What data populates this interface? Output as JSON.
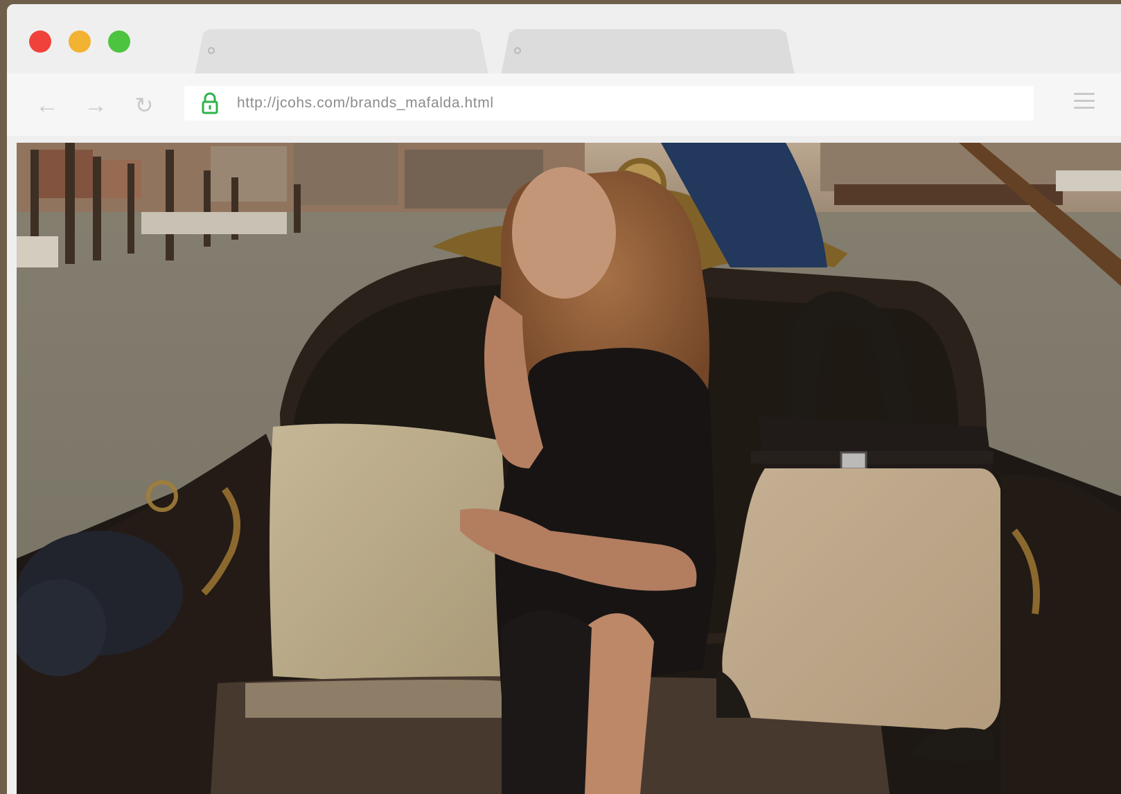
{
  "window": {
    "traffic_lights": {
      "close": "#f0423b",
      "minimize": "#f2b232",
      "maximize": "#4dc43f"
    },
    "tabs": [
      {
        "label": ""
      },
      {
        "label": ""
      }
    ]
  },
  "toolbar": {
    "back_icon": "back-arrow-icon",
    "forward_icon": "forward-arrow-icon",
    "reload_icon": "reload-icon",
    "lock_icon": "lock-icon",
    "lock_color": "#2db34a",
    "url": "http://jcohs.com/brands_mafalda.html",
    "menu_icon": "hamburger-menu-icon"
  },
  "page": {
    "image": "woman-in-gondola-with-handbag"
  }
}
